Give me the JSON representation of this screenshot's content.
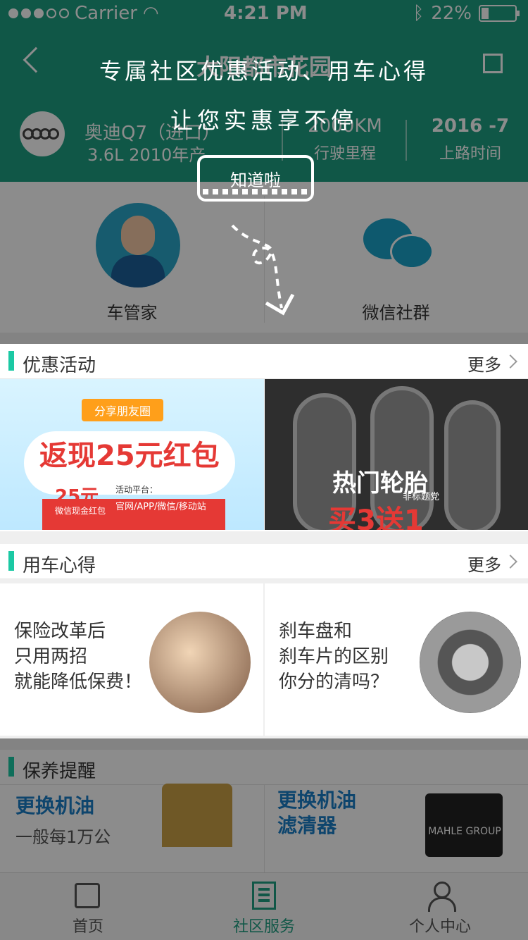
{
  "status_bar": {
    "carrier": "Carrier",
    "time": "4:21 PM",
    "battery": "22%",
    "battery_level": 0.22
  },
  "header": {
    "title": "大阳都市花园",
    "car": {
      "model": "奥迪Q7（进口）",
      "spec": "3.6L 2010年产"
    },
    "mileage": {
      "value": "2000KM",
      "label": "行驶里程"
    },
    "date": {
      "value": "2016 -7",
      "label": "上路时间"
    }
  },
  "services": [
    {
      "label": "车管家",
      "icon": "butler-avatar-icon"
    },
    {
      "label": "微信社群",
      "icon": "wechat-icon"
    }
  ],
  "coach": {
    "line1": "专属社区优惠活动、用车心得",
    "line2": "让您实惠享不停",
    "button": "知道啦"
  },
  "promo_section": {
    "title": "优惠活动",
    "more": "更多",
    "banner_a": {
      "badge": "分享朋友圈",
      "headline": "返现25元红包",
      "amount": "25元",
      "amount_caption": "微信现金红包",
      "platform_label": "活动平台：",
      "channels": "官网/APP/微信/移动站"
    },
    "banner_b": {
      "headline": "热门轮胎",
      "sub": "非标题党",
      "big": "买3送1"
    }
  },
  "experience_section": {
    "title": "用车心得",
    "more": "更多",
    "items": [
      {
        "text": "保险改革后\n只用两招\n就能降低保费！"
      },
      {
        "text": "刹车盘和\n刹车片的区别\n你分的清吗？"
      }
    ]
  },
  "maintenance_section": {
    "title": "保养提醒",
    "items": [
      {
        "title": "更换机油",
        "sub": "一般每1万公"
      },
      {
        "title": "更换机油\n滤清器",
        "product": "MAHLE GROUP"
      }
    ]
  },
  "tabbar": [
    {
      "label": "首页",
      "icon": "home-icon"
    },
    {
      "label": "社区服务",
      "icon": "community-building-icon",
      "active": true
    },
    {
      "label": "个人中心",
      "icon": "user-icon"
    }
  ]
}
